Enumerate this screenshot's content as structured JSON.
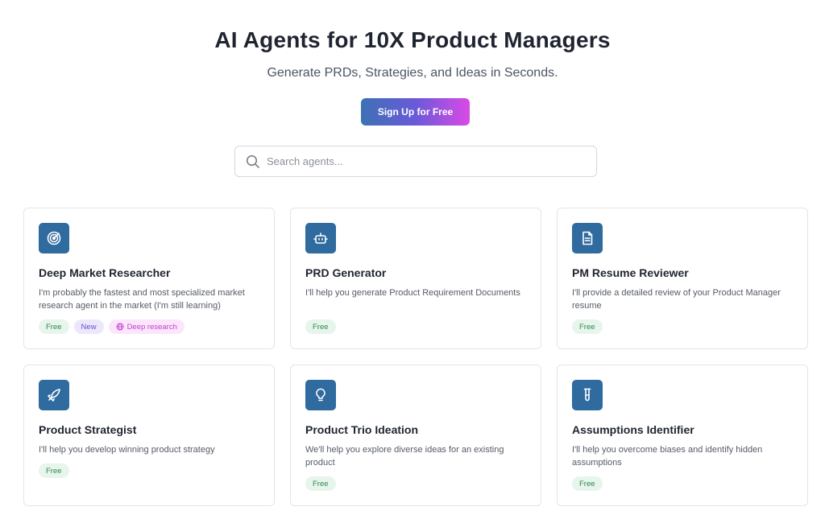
{
  "hero": {
    "title": "AI Agents for 10X Product Managers",
    "subtitle": "Generate PRDs, Strategies, and Ideas in Seconds.",
    "cta_label": "Sign Up for Free"
  },
  "search": {
    "placeholder": "Search agents...",
    "value": ""
  },
  "colors": {
    "icon_bg": "#2f6b9e",
    "cta_gradient": [
      "#3d72b4",
      "#d94ae6"
    ]
  },
  "agents": [
    {
      "icon": "radar-target-icon",
      "title": "Deep Market Researcher",
      "description": "I'm probably the fastest and most specialized market research agent in the market (I'm still learning)",
      "tags": [
        "Free",
        "New",
        "Deep research"
      ]
    },
    {
      "icon": "robot-icon",
      "title": "PRD Generator",
      "description": "I'll help you generate Product Requirement Documents",
      "tags": [
        "Free"
      ]
    },
    {
      "icon": "document-icon",
      "title": "PM Resume Reviewer",
      "description": "I'll provide a detailed review of your Product Manager resume",
      "tags": [
        "Free"
      ]
    },
    {
      "icon": "rocket-icon",
      "title": "Product Strategist",
      "description": "I'll help you develop winning product strategy",
      "tags": [
        "Free"
      ]
    },
    {
      "icon": "lightbulb-icon",
      "title": "Product Trio Ideation",
      "description": "We'll help you explore diverse ideas for an existing product",
      "tags": [
        "Free"
      ]
    },
    {
      "icon": "test-tube-icon",
      "title": "Assumptions Identifier",
      "description": "I'll help you overcome biases and identify hidden assumptions",
      "tags": [
        "Free"
      ]
    }
  ]
}
